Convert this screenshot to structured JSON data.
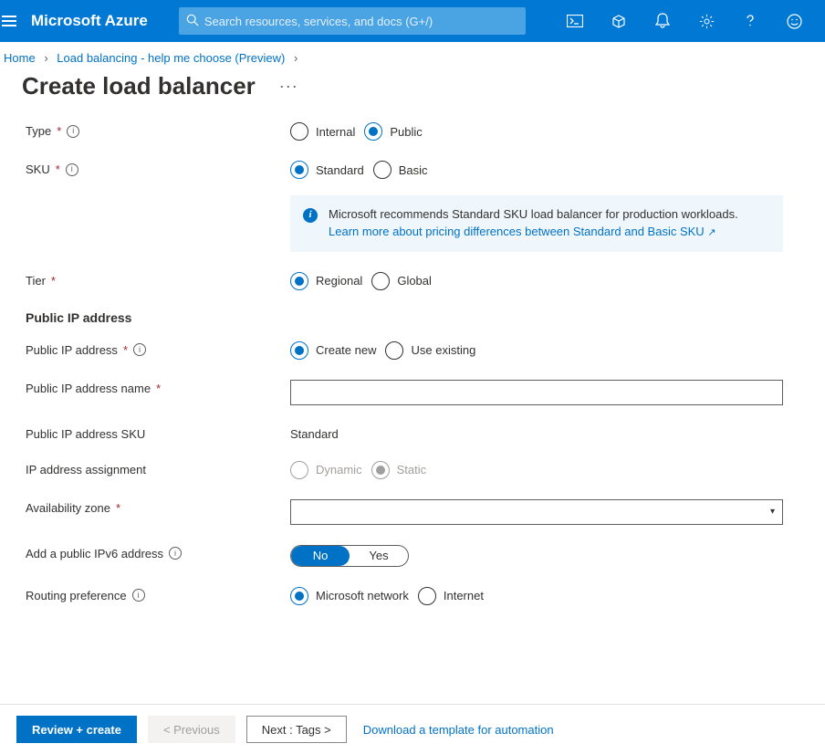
{
  "topbar": {
    "brand": "Microsoft Azure",
    "search_placeholder": "Search resources, services, and docs (G+/)"
  },
  "breadcrumb": {
    "home": "Home",
    "second": "Load balancing - help me choose (Preview)"
  },
  "page": {
    "title": "Create load balancer"
  },
  "form": {
    "type_label": "Type",
    "type_opts": {
      "internal": "Internal",
      "public": "Public"
    },
    "sku_label": "SKU",
    "sku_opts": {
      "standard": "Standard",
      "basic": "Basic"
    },
    "sku_info_text": "Microsoft recommends Standard SKU load balancer for production workloads.",
    "sku_info_link": "Learn more about pricing differences between Standard and Basic SKU",
    "tier_label": "Tier",
    "tier_opts": {
      "regional": "Regional",
      "global": "Global"
    },
    "section_public_ip": "Public IP address",
    "pip_label": "Public IP address",
    "pip_opts": {
      "create": "Create new",
      "existing": "Use existing"
    },
    "pip_name_label": "Public IP address name",
    "pip_sku_label": "Public IP address SKU",
    "pip_sku_value": "Standard",
    "ip_assign_label": "IP address assignment",
    "ip_assign_opts": {
      "dynamic": "Dynamic",
      "static": "Static"
    },
    "az_label": "Availability zone",
    "ipv6_label": "Add a public IPv6 address",
    "ipv6_opts": {
      "no": "No",
      "yes": "Yes"
    },
    "routing_label": "Routing preference",
    "routing_opts": {
      "ms": "Microsoft network",
      "internet": "Internet"
    }
  },
  "footer": {
    "review": "Review + create",
    "prev": "< Previous",
    "next": "Next : Tags >",
    "dl_template": "Download a template for automation"
  }
}
